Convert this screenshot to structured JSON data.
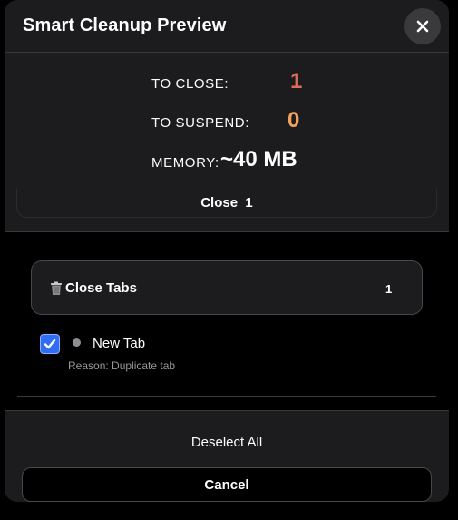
{
  "header": {
    "title": "Smart Cleanup Preview",
    "close_icon": "close-icon"
  },
  "summary": {
    "to_close_label": "TO CLOSE:",
    "to_close_value": "1",
    "to_suspend_label": "TO SUSPEND:",
    "to_suspend_value": "0",
    "memory_label": "MEMORY:",
    "memory_value": "~40 MB",
    "close_label": "Close",
    "close_count": "1"
  },
  "colors": {
    "close": "#e06c5c",
    "suspend": "#f5a25d",
    "accent": "#2f6df5"
  },
  "group": {
    "icon": "trash-icon",
    "label": "Close Tabs",
    "count": "1"
  },
  "tabs": [
    {
      "checked": true,
      "title": "New Tab",
      "reason": "Reason: Duplicate tab"
    }
  ],
  "footer": {
    "deselect_label": "Deselect All",
    "cancel_label": "Cancel"
  }
}
